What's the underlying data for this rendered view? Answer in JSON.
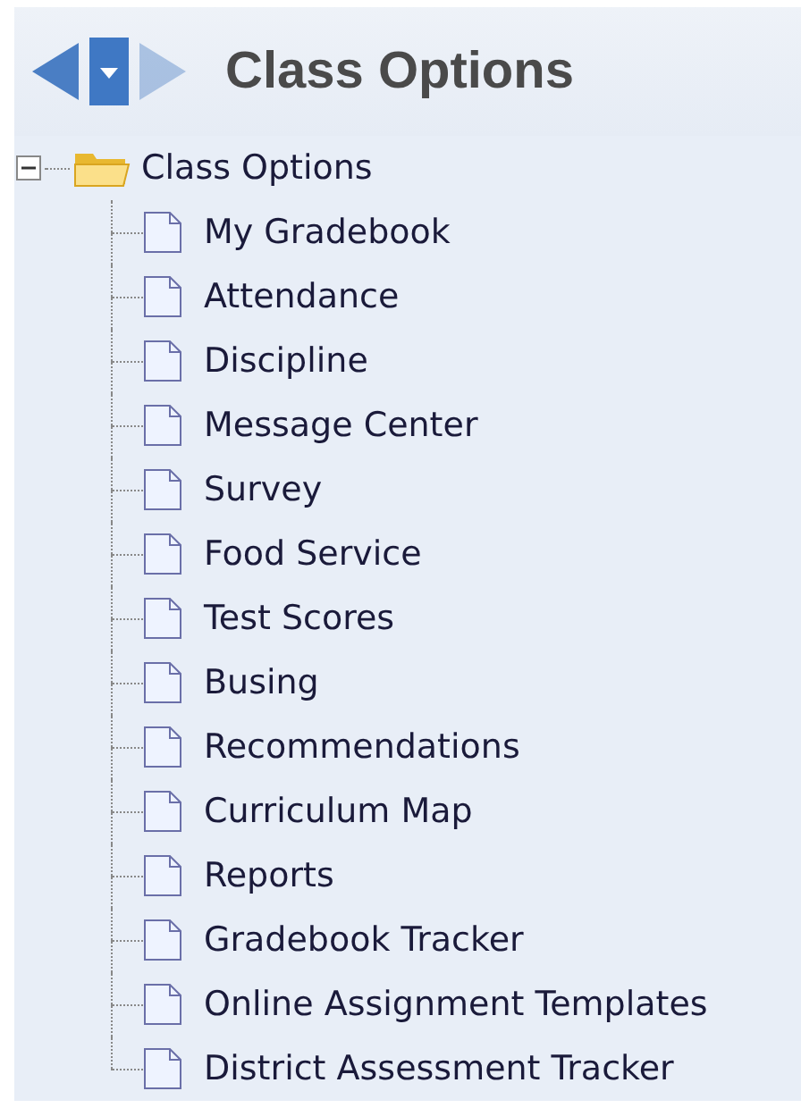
{
  "header": {
    "title": "Class Options",
    "back_disabled": false,
    "forward_disabled": true
  },
  "tree": {
    "label": "Class Options",
    "expanded": true,
    "children": [
      {
        "label": "My Gradebook"
      },
      {
        "label": "Attendance"
      },
      {
        "label": "Discipline"
      },
      {
        "label": "Message Center"
      },
      {
        "label": "Survey"
      },
      {
        "label": "Food Service"
      },
      {
        "label": "Test Scores"
      },
      {
        "label": "Busing"
      },
      {
        "label": "Recommendations"
      },
      {
        "label": "Curriculum Map"
      },
      {
        "label": "Reports"
      },
      {
        "label": "Gradebook Tracker"
      },
      {
        "label": "Online Assignment Templates"
      },
      {
        "label": "District Assessment Tracker"
      }
    ]
  }
}
